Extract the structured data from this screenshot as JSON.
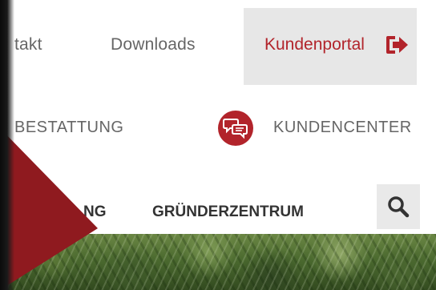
{
  "topnav": {
    "kontakt": "takt",
    "downloads": "Downloads",
    "kundenportal": "Kundenportal",
    "portal_icon": "exit-icon"
  },
  "row2": {
    "bestattung": "BESTATTUNG",
    "kundencenter": "KUNDENCENTER",
    "kundencenter_icon": "chat-bubbles-icon"
  },
  "mainnav": {
    "partial": "NG",
    "gruenderzentrum": "GRÜNDERZENTRUM",
    "search_icon": "search-icon"
  },
  "colors": {
    "accent": "#b2242b",
    "dark_red": "#8f1a1f",
    "text_gray": "#666666",
    "nav_text": "#333333",
    "box_bg": "#e7e7e7"
  }
}
